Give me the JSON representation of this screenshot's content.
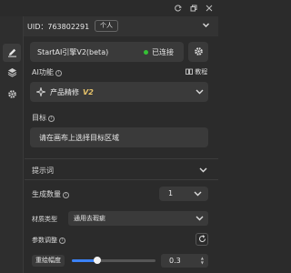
{
  "user": {
    "uid_text": "UID：763802291",
    "badge": "个人"
  },
  "engine": {
    "name": "StartAI引擎V2(beta)",
    "status": "已连接",
    "status_color": "#35c135"
  },
  "ai_function": {
    "label": "AI功能",
    "tutorial_label": "教程",
    "selected": "产品精修",
    "version": "V2",
    "version_color": "#e8c46a"
  },
  "target": {
    "label": "目标",
    "value": "请在画布上选择目标区域"
  },
  "prompt": {
    "label": "提示词"
  },
  "gen_count": {
    "label": "生成数量",
    "value": "1"
  },
  "material": {
    "label": "材质类型",
    "value": "通用去瑕疵"
  },
  "params": {
    "label": "参数调整"
  },
  "amplitude": {
    "label": "重绘幅度",
    "value": "0.3",
    "fraction": 0.3
  },
  "accent_color": "#3b82f6",
  "icons": [
    "refresh-icon",
    "restore-window-icon",
    "close-icon",
    "users-icon",
    "chevron-down-icon",
    "pen-icon",
    "layers-icon",
    "gear-icon",
    "book-icon",
    "info-icon",
    "sparkle-icon",
    "reset-icon"
  ]
}
